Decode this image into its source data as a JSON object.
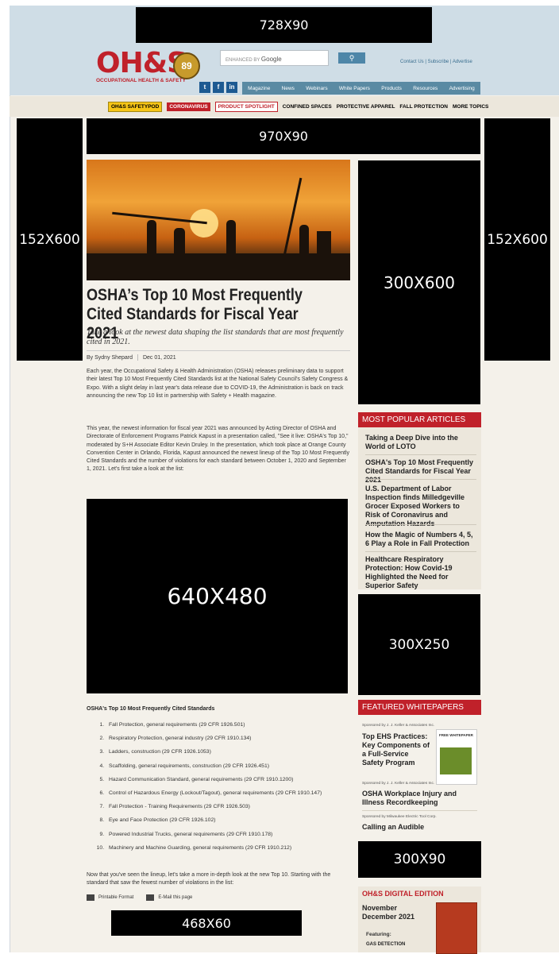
{
  "ads": {
    "leaderboard": "728X90",
    "billboard": "970X90",
    "skyscraper_left": "152X600",
    "skyscraper_right": "152X600",
    "half_page": "300X600",
    "content": "640X480",
    "medium_rect": "300X250",
    "small_banner": "300X90",
    "footer_banner": "468X60"
  },
  "header": {
    "logo_text": "OH&S",
    "logo_tagline": "OCCUPATIONAL HEALTH & SAFETY",
    "logo_badge": "89",
    "search_placeholder": "ENHANCED BY",
    "search_brand": "Google",
    "search_button_icon": "search-icon",
    "top_links": "Contact Us | Subscribe | Advertise",
    "social": [
      "twitter-icon",
      "facebook-icon",
      "linkedin-icon"
    ],
    "social_glyphs": [
      "t",
      "f",
      "in"
    ],
    "nav": [
      "Magazine",
      "News",
      "Webinars",
      "White Papers",
      "Products",
      "Resources",
      "Advertising"
    ]
  },
  "topics": {
    "safetypod": "OH&S SAFETYPOD",
    "coronavirus": "CORONAVIRUS",
    "spotlight": "PRODUCT SPOTLIGHT",
    "confined": "CONFINED SPACES",
    "apparel": "PROTECTIVE APPAREL",
    "fall": "FALL PROTECTION",
    "more": "MORE TOPICS"
  },
  "article": {
    "title": "OSHA’s Top 10 Most Frequently Cited Standards for Fiscal Year 2021",
    "deck": "Take a look at the newest data shaping the list standards that are most frequently cited in 2021.",
    "author": "By Sydny Shepard",
    "date": "Dec 01, 2021",
    "p1": "Each year, the Occupational Safety & Health Administration (OSHA) releases preliminary data to support their latest Top 10 Most Frequently Cited Standards list at the National Safety Council's Safety Congress & Expo. With a slight delay in last year's data release due to COVID-19, the Administration is back on track announcing the new Top 10 list in partnership with Safety + Health magazine.",
    "p2": "This year, the newest information for fiscal year 2021 was announced by Acting Director of OSHA and Directorate of Enforcement Programs Patrick Kapust in a presentation called, \"See it live: OSHA's Top 10,\" moderated by S+H Associate Editor Kevin Druley. In the presentation, which took place at Orange County Convention Center in Orlando, Florida, Kapust announced the newest lineup of the Top 10 Most Frequently Cited Standards and the number of violations for each standard between October 1, 2020 and September 1, 2021. Let's first take a look at the list:",
    "list_title": "OSHA's Top 10 Most Frequently Cited Standards",
    "list": [
      "Fall Protection, general requirements (29 CFR 1926.501)",
      "Respiratory Protection, general industry (29 CFR 1910.134)",
      "Ladders, construction (29 CFR 1926.1053)",
      "Scaffolding, general requirements, construction (29 CFR 1926.451)",
      "Hazard Communication Standard, general requirements (29 CFR 1910.1200)",
      "Control of Hazardous Energy (Lockout/Tagout), general requirements (29 CFR 1910.147)",
      "Fall Protection - Training Requirements (29 CFR 1926.503)",
      "Eye and Face Protection (29 CFR 1926.102)",
      "Powered Industrial Trucks, general requirements (29 CFR 1910.178)",
      "Machinery and Machine Guarding, general requirements (29 CFR 1910.212)"
    ],
    "p3": "Now that you've seen the lineup, let's take a more in-depth look at the new Top 10. Starting with the standard that saw the fewest number of violations in the list:",
    "print_label": "Printable Format",
    "email_label": "E-Mail this page"
  },
  "most_popular": {
    "heading": "MOST POPULAR ARTICLES",
    "items": [
      "Taking a Deep Dive into the World of LOTO",
      "OSHA's Top 10 Most Frequently Cited Standards for Fiscal Year 2021",
      "U.S. Department of Labor Inspection finds Milledgeville Grocer Exposed Workers to Risk of Coronavirus and Amputation Hazards",
      "How the Magic of Numbers 4, 5, 6 Play a Role in Fall Protection",
      "Healthcare Respiratory Protection: How Covid-19 Highlighted the Need for Superior Safety"
    ]
  },
  "whitepapers": {
    "heading": "FEATURED WHITEPAPERS",
    "items": [
      {
        "sponsor": "Sponsored by J. J. Keller & Associates Inc.",
        "title": "Top EHS Practices: Key Components of a Full-Service Safety Program",
        "cover_label": "FREE WHITEPAPER"
      },
      {
        "sponsor": "Sponsored by J. J. Keller & Associates Inc.",
        "title": "OSHA Workplace Injury and Illness Recordkeeping"
      },
      {
        "sponsor": "Sponsored by Milwaukee Electric Tool Corp.",
        "title": "Calling an Audible"
      }
    ]
  },
  "digital_edition": {
    "heading": "OH&S DIGITAL EDITION",
    "issue": "November December 2021",
    "featuring": "Featuring:",
    "feature1": "GAS DETECTION"
  }
}
